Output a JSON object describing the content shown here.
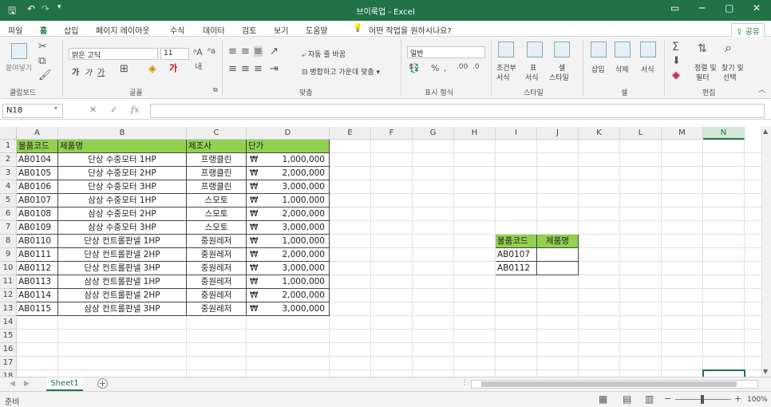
{
  "window": {
    "title": "브이룩업  -  Excel",
    "qat_save_icon": "save-icon",
    "minimize": "─",
    "restore": "▢",
    "close": "✕"
  },
  "menu": {
    "items": [
      "파일",
      "홈",
      "삽입",
      "페이지 레이아웃",
      "수식",
      "데이터",
      "검토",
      "보기",
      "도움말"
    ],
    "tell_me": "어떤 작업을 원하시나요?",
    "share": "공유"
  },
  "ribbon": {
    "clipboard": {
      "paste": "붙여넣기",
      "label": "클립보드"
    },
    "font": {
      "name": "맑은 고딕",
      "size": "11",
      "bold": "가",
      "italic": "가",
      "underline": "가",
      "label": "글꼴"
    },
    "alignment": {
      "wrap": "자동 줄 바꿈",
      "merge": "병합하고 가운데 맞춤",
      "label": "맞춤"
    },
    "number": {
      "format": "일반",
      "label": "표시 형식"
    },
    "styles": {
      "conditional": "조건부",
      "conditional2": "서식",
      "table": "표",
      "table2": "서식",
      "cell": "셀",
      "cell2": "스타일",
      "label": "스타일"
    },
    "cells": {
      "insert": "삽입",
      "delete": "삭제",
      "format": "서식",
      "label": "셀"
    },
    "editing": {
      "sort": "정렬 및",
      "sort2": "필터",
      "find": "찾기 및",
      "find2": "선택",
      "label": "편집"
    }
  },
  "formula_bar": {
    "name_box": "N18",
    "cancel": "✕",
    "enter": "✓",
    "fx": "fx",
    "value": ""
  },
  "columns": [
    "A",
    "B",
    "C",
    "D",
    "E",
    "F",
    "G",
    "H",
    "I",
    "J",
    "K",
    "L",
    "M",
    "N"
  ],
  "rows": [
    "1",
    "2",
    "3",
    "4",
    "5",
    "6",
    "7",
    "8",
    "9",
    "10",
    "11",
    "12",
    "13",
    "14",
    "15",
    "16",
    "17",
    "18"
  ],
  "table": {
    "headers": [
      "물품코드",
      "제품명",
      "제조사",
      "단가"
    ],
    "currency": "₩",
    "rows": [
      [
        "AB0104",
        "단상 수중모터 1HP",
        "프랭클린",
        "1,000,000"
      ],
      [
        "AB0105",
        "단상 수중모터 2HP",
        "프랭클린",
        "2,000,000"
      ],
      [
        "AB0106",
        "단상 수중모터 3HP",
        "프랭클린",
        "3,000,000"
      ],
      [
        "AB0107",
        "삼상 수중모터 1HP",
        "스모토",
        "1,000,000"
      ],
      [
        "AB0108",
        "삼상 수중모터 2HP",
        "스모토",
        "2,000,000"
      ],
      [
        "AB0109",
        "삼상 수중모터 3HP",
        "스모토",
        "3,000,000"
      ],
      [
        "AB0110",
        "단상 컨트롤판넬 1HP",
        "중원레저",
        "1,000,000"
      ],
      [
        "AB0111",
        "단상 컨트롤판넬 2HP",
        "중원레저",
        "2,000,000"
      ],
      [
        "AB0112",
        "단상 컨트롤판넬 3HP",
        "중원레저",
        "3,000,000"
      ],
      [
        "AB0113",
        "삼상 컨트롤판넬 1HP",
        "중원레저",
        "1,000,000"
      ],
      [
        "AB0114",
        "삼상 컨트롤판넬 2HP",
        "중원레저",
        "2,000,000"
      ],
      [
        "AB0115",
        "삼상 컨트롤판넬 3HP",
        "중원레저",
        "3,000,000"
      ]
    ]
  },
  "lookup": {
    "headers": [
      "물품코드",
      "제품명"
    ],
    "rows": [
      [
        "AB0107",
        ""
      ],
      [
        "AB0112",
        ""
      ]
    ]
  },
  "sheet_tabs": {
    "active": "Sheet1",
    "add": "+"
  },
  "status": {
    "ready": "준비",
    "zoom": "100%"
  },
  "colors": {
    "header_green": "#92d050",
    "excel_green": "#217346"
  }
}
